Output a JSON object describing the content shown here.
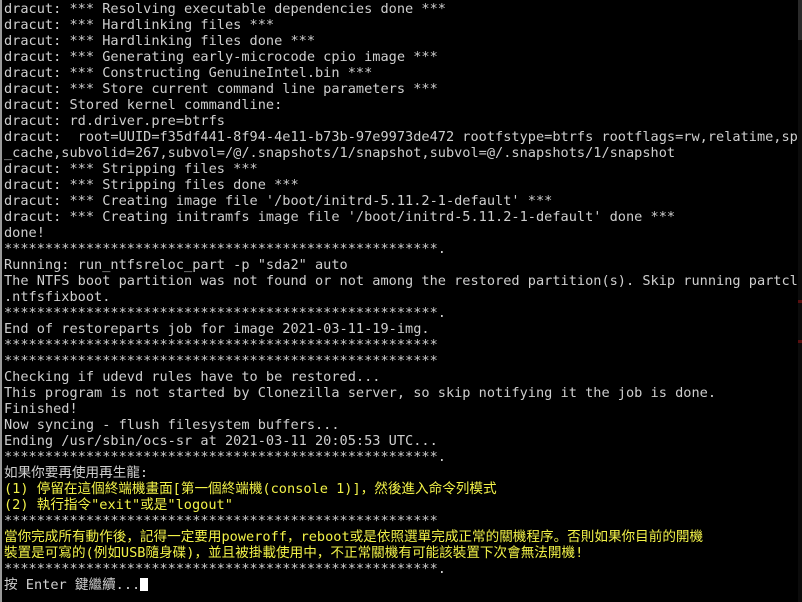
{
  "terminal": {
    "title": "Clonezilla ocs-sr console",
    "colors": {
      "background": "#000000",
      "foreground": "#cfcfcf",
      "yellow": "#f2f248",
      "cursor": "#ffffff",
      "border": "#9a9a9a"
    },
    "cursor": {
      "glyph": "block",
      "visible": true
    },
    "lines": [
      {
        "text": "dracut: *** Resolving executable dependencies done ***",
        "color": "white"
      },
      {
        "text": "dracut: *** Hardlinking files ***",
        "color": "white"
      },
      {
        "text": "dracut: *** Hardlinking files done ***",
        "color": "white"
      },
      {
        "text": "dracut: *** Generating early-microcode cpio image ***",
        "color": "white"
      },
      {
        "text": "dracut: *** Constructing GenuineIntel.bin ***",
        "color": "white"
      },
      {
        "text": "dracut: *** Store current command line parameters ***",
        "color": "white"
      },
      {
        "text": "dracut: Stored kernel commandline:",
        "color": "white"
      },
      {
        "text": "dracut: rd.driver.pre=btrfs",
        "color": "white"
      },
      {
        "text": "dracut:  root=UUID=f35df441-8f94-4e11-b73b-97e9973de472 rootfstype=btrfs rootflags=rw,relatime,space",
        "color": "white"
      },
      {
        "text": "_cache,subvolid=267,subvol=/@/.snapshots/1/snapshot,subvol=@/.snapshots/1/snapshot",
        "color": "white"
      },
      {
        "text": "dracut: *** Stripping files ***",
        "color": "white"
      },
      {
        "text": "dracut: *** Stripping files done ***",
        "color": "white"
      },
      {
        "text": "dracut: *** Creating image file '/boot/initrd-5.11.2-1-default' ***",
        "color": "white"
      },
      {
        "text": "dracut: *** Creating initramfs image file '/boot/initrd-5.11.2-1-default' done ***",
        "color": "white"
      },
      {
        "text": "done!",
        "color": "white"
      },
      {
        "text": "*****************************************************.",
        "color": "white"
      },
      {
        "text": "Running: run_ntfsreloc_part -p \"sda2\" auto",
        "color": "white"
      },
      {
        "text": "The NTFS boot partition was not found or not among the restored partition(s). Skip running partclone",
        "color": "white"
      },
      {
        "text": ".ntfsfixboot.",
        "color": "white"
      },
      {
        "text": "*****************************************************.",
        "color": "white"
      },
      {
        "text": "End of restoreparts job for image 2021-03-11-19-img.",
        "color": "white"
      },
      {
        "text": "*****************************************************",
        "color": "white"
      },
      {
        "text": "*****************************************************",
        "color": "white"
      },
      {
        "text": "Checking if udevd rules have to be restored...",
        "color": "white"
      },
      {
        "text": "This program is not started by Clonezilla server, so skip notifying it the job is done.",
        "color": "white"
      },
      {
        "text": "Finished!",
        "color": "white"
      },
      {
        "text": "Now syncing - flush filesystem buffers...",
        "color": "white"
      },
      {
        "text": "Ending /usr/sbin/ocs-sr at 2021-03-11 20:05:53 UTC...",
        "color": "white"
      },
      {
        "text": "*****************************************************.",
        "color": "white"
      },
      {
        "text": "如果你要再使用再生龍:",
        "color": "white"
      },
      {
        "text": "(1) 停留在這個終端機畫面[第一個終端機(console 1)]，然後進入命令列模式",
        "color": "yellow"
      },
      {
        "text": "(2) 執行指令\"exit\"或是\"logout\"",
        "color": "yellow"
      },
      {
        "text": "*****************************************************",
        "color": "white"
      },
      {
        "text": "當你完成所有動作後，記得一定要用poweroff，reboot或是依照選單完成正常的關機程序。否則如果你目前的開機",
        "color": "yellow"
      },
      {
        "text": "裝置是可寫的(例如USB隨身碟)，並且被掛載使用中，不正常關機有可能該裝置下次會無法開機!",
        "color": "yellow"
      },
      {
        "text": "*****************************************************.",
        "color": "white"
      },
      {
        "text": "按 Enter 鍵繼續...",
        "color": "white",
        "cursor": true
      }
    ]
  }
}
